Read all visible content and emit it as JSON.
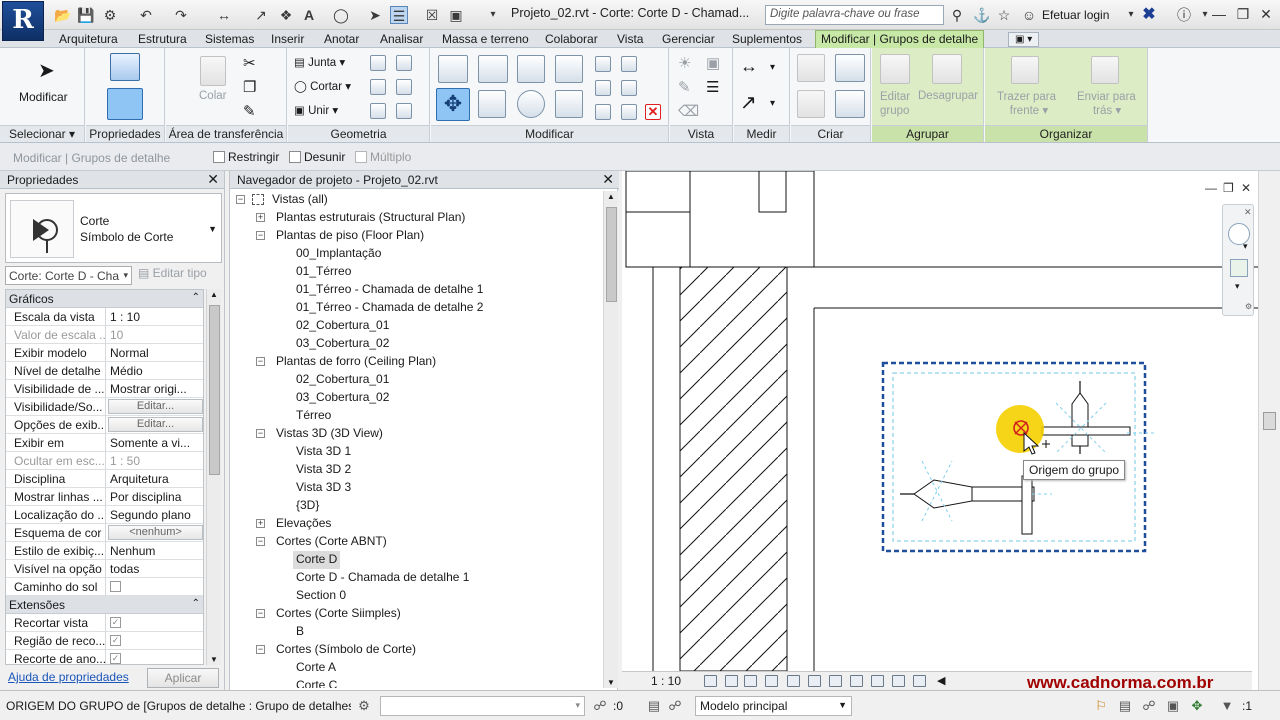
{
  "titlebar": {
    "title": "Projeto_02.rvt - Corte: Corte D - Chamad...",
    "search_placeholder": "Digite palavra-chave ou frase",
    "login": "Efetuar login",
    "app_logo": "R"
  },
  "tabs": [
    {
      "label": "Arquitetura"
    },
    {
      "label": "Estrutura"
    },
    {
      "label": "Sistemas"
    },
    {
      "label": "Inserir"
    },
    {
      "label": "Anotar"
    },
    {
      "label": "Analisar"
    },
    {
      "label": "Massa e terreno"
    },
    {
      "label": "Colaborar"
    },
    {
      "label": "Vista"
    },
    {
      "label": "Gerenciar"
    },
    {
      "label": "Suplementos"
    },
    {
      "label": "Modificar | Grupos de detalhe"
    }
  ],
  "ribbon": {
    "select": {
      "label": "Selecionar",
      "modify": "Modificar"
    },
    "properties": {
      "label": "Propriedades"
    },
    "clipboard": {
      "label": "Área de transferência",
      "paste": "Colar"
    },
    "geometry": {
      "label": "Geometria",
      "join": "Junta",
      "cut": "Cortar",
      "unite": "Unir"
    },
    "modify": {
      "label": "Modificar"
    },
    "view": {
      "label": "Vista"
    },
    "measure": {
      "label": "Medir"
    },
    "create": {
      "label": "Criar"
    },
    "group": {
      "label": "Agrupar",
      "edit_group": [
        "Editar",
        "grupo"
      ],
      "ungroup": "Desagrupar"
    },
    "arrange": {
      "label": "Organizar",
      "bring_front": [
        "Trazer para",
        "frente"
      ],
      "send_back": [
        "Enviar para",
        "trás"
      ]
    }
  },
  "options_bar": {
    "context": "Modificar | Grupos de detalhe",
    "restrict": "Restringir",
    "disjoin": "Desunir",
    "multiple": "Múltiplo"
  },
  "properties": {
    "title": "Propriedades",
    "type_name": "Corte",
    "type_sub": "Símbolo de Corte",
    "instance_filter": "Corte: Corte D - Cha",
    "edit_type": "Editar tipo",
    "groups": [
      {
        "name": "Gráficos",
        "rows": [
          {
            "name": "Escala da vista",
            "value": "1 : 10"
          },
          {
            "name": "Valor de escala ...",
            "value": "10",
            "disabled": true
          },
          {
            "name": "Exibir modelo",
            "value": "Normal"
          },
          {
            "name": "Nível de detalhe",
            "value": "Médio"
          },
          {
            "name": "Visibilidade de ...",
            "value": "Mostrar origi..."
          },
          {
            "name": "Visibilidade/So...",
            "button": "Editar..."
          },
          {
            "name": "Opções de exib...",
            "button": "Editar..."
          },
          {
            "name": "Exibir em",
            "value": "Somente a vi..."
          },
          {
            "name": "Ocultar em esc...",
            "value": "1 : 50",
            "disabled": true
          },
          {
            "name": "Disciplina",
            "value": "Arquitetura"
          },
          {
            "name": "Mostrar linhas ...",
            "value": "Por disciplina"
          },
          {
            "name": "Localização do ...",
            "value": "Segundo plano"
          },
          {
            "name": "Esquema de cor",
            "button": "<nenhum>"
          },
          {
            "name": "Estilo de exibiç...",
            "value": "Nenhum"
          },
          {
            "name": "Visível na opção",
            "value": "todas"
          },
          {
            "name": "Caminho do sol",
            "checkbox": true
          }
        ]
      },
      {
        "name": "Extensões",
        "rows": [
          {
            "name": "Recortar vista",
            "checkbox": true
          },
          {
            "name": "Região de reco...",
            "checkbox": true
          },
          {
            "name": "Recorte de ano...",
            "checkbox": true
          }
        ]
      }
    ],
    "help_link": "Ajuda de propriedades",
    "apply": "Aplicar"
  },
  "browser": {
    "title": "Navegador de projeto - Projeto_02.rvt",
    "tree": [
      {
        "label": "Vistas (all)",
        "level": 0,
        "twisty": "-",
        "icon": true
      },
      {
        "label": "Plantas estruturais (Structural Plan)",
        "level": 1,
        "twisty": "+"
      },
      {
        "label": "Plantas de piso (Floor Plan)",
        "level": 1,
        "twisty": "-"
      },
      {
        "label": "00_Implantação",
        "level": 2
      },
      {
        "label": "01_Térreo",
        "level": 2
      },
      {
        "label": "01_Térreo - Chamada de detalhe 1",
        "level": 2
      },
      {
        "label": "01_Térreo - Chamada de detalhe 2",
        "level": 2
      },
      {
        "label": "02_Cobertura_01",
        "level": 2
      },
      {
        "label": "03_Cobertura_02",
        "level": 2
      },
      {
        "label": "Plantas de forro (Ceiling Plan)",
        "level": 1,
        "twisty": "-"
      },
      {
        "label": "02_Cobertura_01",
        "level": 2
      },
      {
        "label": "03_Cobertura_02",
        "level": 2
      },
      {
        "label": "Térreo",
        "level": 2
      },
      {
        "label": "Vistas 3D (3D View)",
        "level": 1,
        "twisty": "-"
      },
      {
        "label": "Vista 3D 1",
        "level": 2
      },
      {
        "label": "Vista 3D 2",
        "level": 2
      },
      {
        "label": "Vista 3D 3",
        "level": 2
      },
      {
        "label": "{3D}",
        "level": 2
      },
      {
        "label": "Elevações",
        "level": 1,
        "twisty": "+"
      },
      {
        "label": "Cortes (Corte ABNT)",
        "level": 1,
        "twisty": "-"
      },
      {
        "label": "Corte D",
        "level": 2,
        "selected": true
      },
      {
        "label": "Corte D - Chamada de detalhe 1",
        "level": 2
      },
      {
        "label": "Section 0",
        "level": 2
      },
      {
        "label": "Cortes (Corte Siimples)",
        "level": 1,
        "twisty": "-"
      },
      {
        "label": "B",
        "level": 2
      },
      {
        "label": "Cortes (Símbolo de Corte)",
        "level": 1,
        "twisty": "-"
      },
      {
        "label": "Corte A",
        "level": 2
      },
      {
        "label": "Corte C",
        "level": 2
      }
    ]
  },
  "canvas": {
    "tooltip": "Origem do grupo",
    "scale": "1 : 10",
    "watermark": "www.cadnorma.com.br"
  },
  "statusbar": {
    "message": "ORIGEM DO GRUPO de [Grupos de detalhe : Grupo de detalhes : S",
    "workset_count": ":0",
    "model": "Modelo principal",
    "filter_count": ":1"
  },
  "colors": {
    "accent_green": "#c7e8a6",
    "selection_blue": "#1f4e9c",
    "highlight_yellow": "#f5d000",
    "watermark": "#a00000"
  }
}
